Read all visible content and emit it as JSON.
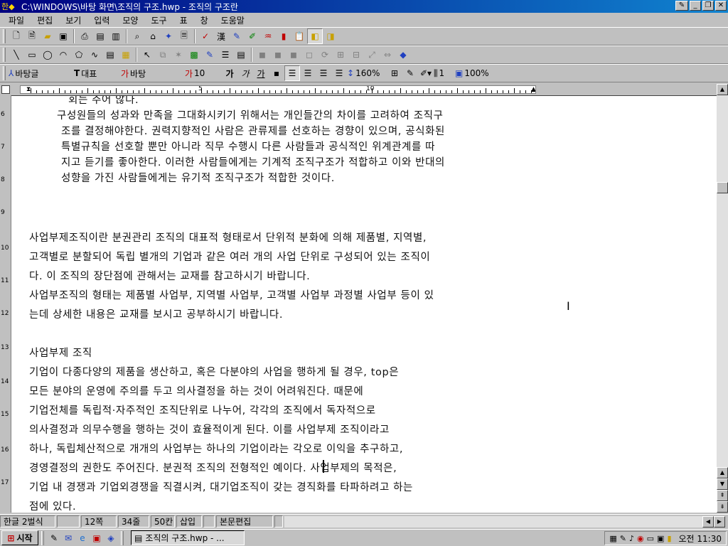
{
  "window": {
    "title": "C:\\WINDOWS\\바탕 화면\\조직의 구조.hwp - 조직의 구조란"
  },
  "menu": [
    "파일",
    "편집",
    "보기",
    "입력",
    "모양",
    "도구",
    "표",
    "창",
    "도움말"
  ],
  "format_bar": {
    "style": "바탕글",
    "font_type": "대표",
    "font": "바탕",
    "size": "10",
    "bold": "가",
    "italic": "가",
    "underline": "가",
    "line_spacing": "160%",
    "columns": "1",
    "zoom": "100%"
  },
  "ruler": {
    "marks": [
      "5",
      "10"
    ]
  },
  "vertical_ruler": [
    "6",
    "7",
    "8",
    "9",
    "10",
    "11",
    "12",
    "13",
    "14",
    "15",
    "16",
    "17"
  ],
  "document": {
    "lines": [
      "회는 주어 않다.",
      "구성원들의 성과와 만족을 그대화시키기 위해서는 개인들간의 차이를 고려하여 조직구",
      "조를 결정해야한다. 권력지향적인 사람은 관류제를 선호하는 경향이 있으며, 공식화된",
      "특별규칙을 선호할 뿐만 아니라 직무 수행시 다른 사람들과 공식적인 위계관계를 따",
      "지고 듣기를 좋아한다. 이러한 사람들에게는 기계적 조직구조가 적합하고 이와 반대의",
      "성향을 가진 사람들에게는 유기적 조직구조가 적합한 것이다.",
      "사업부제조직이란 분권관리 조직의 대표적 형태로서 단위적 분화에 의해 제품별, 지역별,",
      "고객별로 분할되어 독립 별개의 기업과 같은 여러 개의 사업 단위로 구성되어 있는 조직이",
      "다. 이 조직의 장단점에 관해서는 교재를 참고하시기 바랍니다.",
      "사업부조직의 형태는 제품별 사업부, 지역별 사업부, 고객별 사업부 과정별 사업부 등이 있",
      "는데  상세한 내용은 교재를 보시고 공부하시기 바랍니다.",
      " 사업부제 조직",
      "기업이 다종다양의 제품을 생산하고, 혹은 다분야의 사업을 행하게 될 경우, top은",
      "모든 분야의 운영에 주의를 두고 의사결정을 하는 것이 어려워진다. 때문에",
      "기업전체를 독립적·자주적인 조직단위로 나누어, 각각의 조직에서 독자적으로",
      "의사결정과 의무수행을 행하는 것이 효율적이게 된다. 이를 사업부제 조직이라고",
      "하나, 독립체산적으로 개개의 사업부는 하나의 기업이라는 각오로 이익을 추구하고,",
      "경영결정의 권한도 주어진다. 분권적 조직의 전형적인 예이다. 사업부제의 목적은,",
      "기업 내 경쟁과 기업외경쟁을 직결시켜, 대기업조직이 갖는 경직화를 타파하려고 하는",
      "점에 있다."
    ]
  },
  "status": {
    "input_mode": "한글 2벌식",
    "page": "12쪽",
    "line": "34줄",
    "column": "50칸",
    "insert_mode": "삽입",
    "edit_mode": "본문편집"
  },
  "taskbar": {
    "start": "시작",
    "task": "조직의 구조.hwp - ...",
    "clock": "오전 11:30"
  }
}
